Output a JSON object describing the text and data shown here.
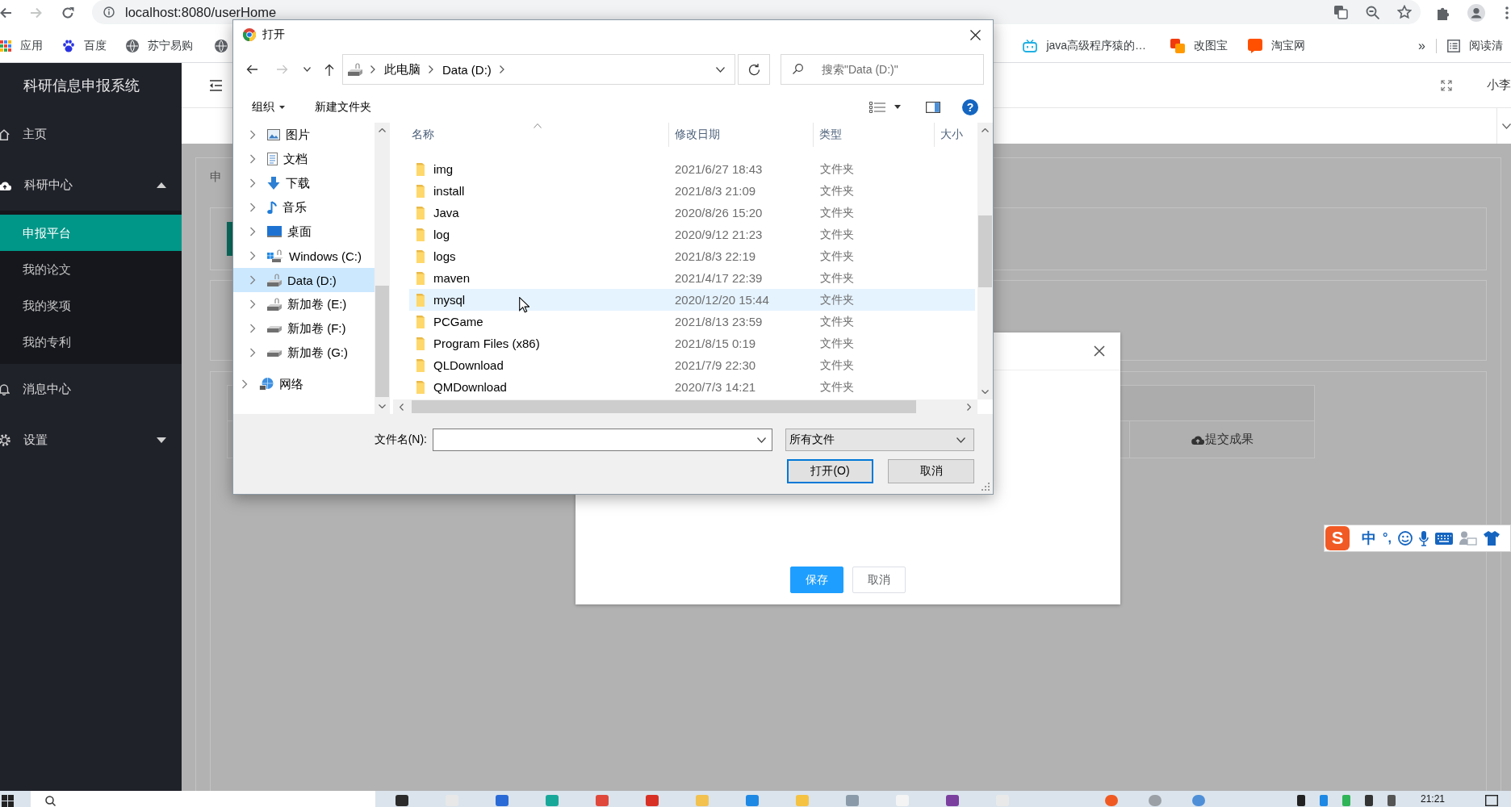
{
  "browser": {
    "back_disabled": false,
    "forward_disabled": true,
    "url": "localhost:8080/userHome",
    "bookmarks": [
      {
        "label": "应用"
      },
      {
        "label": "百度"
      },
      {
        "label": "苏宁易购"
      }
    ],
    "bookmarks_right": [
      {
        "label": "java高级程序猿的…"
      },
      {
        "label": "改图宝"
      },
      {
        "label": "淘宝网"
      }
    ],
    "more": "»",
    "reading_list": "阅读清"
  },
  "app": {
    "title": "科研信息申报系统",
    "user": "小李",
    "sidebar": [
      {
        "label": "主页",
        "kind": "link"
      },
      {
        "label": "科研中心",
        "kind": "group",
        "expanded": true,
        "children": [
          {
            "label": "申报平台",
            "selected": true
          },
          {
            "label": "我的论文",
            "selected": false
          },
          {
            "label": "我的奖项",
            "selected": false
          },
          {
            "label": "我的专利",
            "selected": false
          }
        ]
      },
      {
        "label": "消息中心",
        "kind": "link"
      },
      {
        "label": "设置",
        "kind": "group",
        "expanded": false
      }
    ],
    "breadcrumb": "申",
    "table": {
      "columns": [
        {
          "label": "提交成果"
        }
      ]
    }
  },
  "form_dialog": {
    "buttons": [
      {
        "label": "保存",
        "kind": "primary"
      },
      {
        "label": "取消",
        "kind": "default"
      }
    ]
  },
  "file_dialog": {
    "title": "打开",
    "back_disabled": false,
    "forward_disabled": true,
    "path": [
      "此电脑",
      "Data (D:)"
    ],
    "search": {
      "placeholder": "搜索\"Data (D:)\""
    },
    "toolbar": [
      {
        "label": "组织",
        "kind": "menu"
      },
      {
        "label": "新建文件夹",
        "kind": "plain"
      }
    ],
    "help": "?",
    "nav_items": [
      {
        "label": "图片",
        "expanded": false,
        "selected": false
      },
      {
        "label": "文档",
        "expanded": false,
        "selected": false
      },
      {
        "label": "下载",
        "expanded": false,
        "selected": false
      },
      {
        "label": "音乐",
        "expanded": false,
        "selected": false
      },
      {
        "label": "桌面",
        "expanded": false,
        "selected": false
      },
      {
        "label": "Windows (C:)",
        "expanded": false,
        "selected": false
      },
      {
        "label": "Data (D:)",
        "expanded": false,
        "selected": true
      },
      {
        "label": "新加卷 (E:)",
        "expanded": false,
        "selected": false
      },
      {
        "label": "新加卷 (F:)",
        "expanded": false,
        "selected": false
      },
      {
        "label": "新加卷 (G:)",
        "expanded": false,
        "selected": false
      }
    ],
    "network": {
      "label": "网络",
      "expanded": false,
      "selected": false
    },
    "columns": [
      {
        "label": "名称",
        "sorted": true
      },
      {
        "label": "修改日期",
        "sorted": false
      },
      {
        "label": "类型",
        "sorted": false
      },
      {
        "label": "大小",
        "sorted": false
      }
    ],
    "files": [
      {
        "name": "img",
        "modified": "2021/6/27 18:43",
        "type": "文件夹",
        "hovered": false
      },
      {
        "name": "install",
        "modified": "2021/8/3 21:09",
        "type": "文件夹",
        "hovered": false
      },
      {
        "name": "Java",
        "modified": "2020/8/26 15:20",
        "type": "文件夹",
        "hovered": false
      },
      {
        "name": "log",
        "modified": "2020/9/12 21:23",
        "type": "文件夹",
        "hovered": false
      },
      {
        "name": "logs",
        "modified": "2021/8/3 22:19",
        "type": "文件夹",
        "hovered": false
      },
      {
        "name": "maven",
        "modified": "2021/4/17 22:39",
        "type": "文件夹",
        "hovered": false
      },
      {
        "name": "mysql",
        "modified": "2020/12/20 15:44",
        "type": "文件夹",
        "hovered": true
      },
      {
        "name": "PCGame",
        "modified": "2021/8/13 23:59",
        "type": "文件夹",
        "hovered": false
      },
      {
        "name": "Program Files (x86)",
        "modified": "2021/8/15 0:19",
        "type": "文件夹",
        "hovered": false
      },
      {
        "name": "QLDownload",
        "modified": "2021/7/9 22:30",
        "type": "文件夹",
        "hovered": false
      },
      {
        "name": "QMDownload",
        "modified": "2020/7/3 14:21",
        "type": "文件夹",
        "hovered": false
      }
    ],
    "filename": {
      "label": "文件名(N):"
    },
    "filetype": "所有文件",
    "buttons": [
      {
        "label": "打开(O)",
        "default": true
      },
      {
        "label": "取消",
        "default": false
      }
    ]
  },
  "ime": {
    "logo": "S",
    "mode": "中",
    "punctuation": "°,"
  },
  "taskbar": {
    "time": "21:21"
  }
}
